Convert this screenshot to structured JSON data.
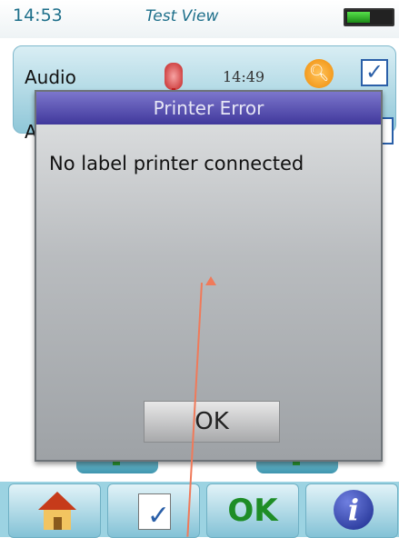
{
  "statusbar": {
    "time": "14:53",
    "title": "Test View",
    "battery_level": 0.55,
    "battery_color": "#2db82a"
  },
  "list": {
    "rows": [
      {
        "label": "Audio",
        "time": "14:49",
        "icons": [
          "audio-icon",
          "search-icon",
          "checkbox-icon"
        ]
      },
      {
        "label": "A",
        "icons": [
          "checkbox-icon"
        ]
      }
    ]
  },
  "dialog": {
    "title": "Printer Error",
    "message": "No label printer connected",
    "ok_label": "OK",
    "title_color": "#4a43a8"
  },
  "toolbar": {
    "buttons": [
      {
        "icon": "home-icon"
      },
      {
        "icon": "tasks-icon"
      },
      {
        "label": "OK",
        "color": "#1e8d26"
      },
      {
        "icon": "info-icon"
      }
    ]
  }
}
